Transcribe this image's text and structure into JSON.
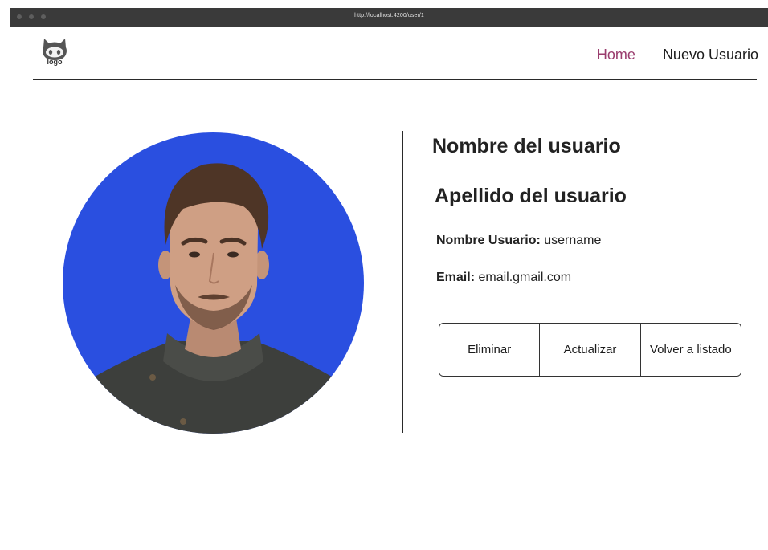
{
  "browser": {
    "url": "http://localhost:4200/user/1"
  },
  "header": {
    "logo_text": "logo",
    "nav": [
      {
        "label": "Home",
        "active": true
      },
      {
        "label": "Nuevo Usuario",
        "active": false
      }
    ]
  },
  "user": {
    "first_name": "Nombre del usuario",
    "last_name": "Apellido del usuario",
    "username_label": "Nombre Usuario:",
    "username_value": "username",
    "email_label": "Email:",
    "email_value": "email.gmail.com"
  },
  "actions": {
    "delete_label": "Eliminar",
    "update_label": "Actualizar",
    "back_label": "Volver a listado"
  },
  "colors": {
    "avatar_background": "#2a4fe0",
    "nav_active": "#9a3d6e",
    "titlebar": "#3a3a3a"
  },
  "icons": {
    "logo": "github-octocat-icon"
  }
}
